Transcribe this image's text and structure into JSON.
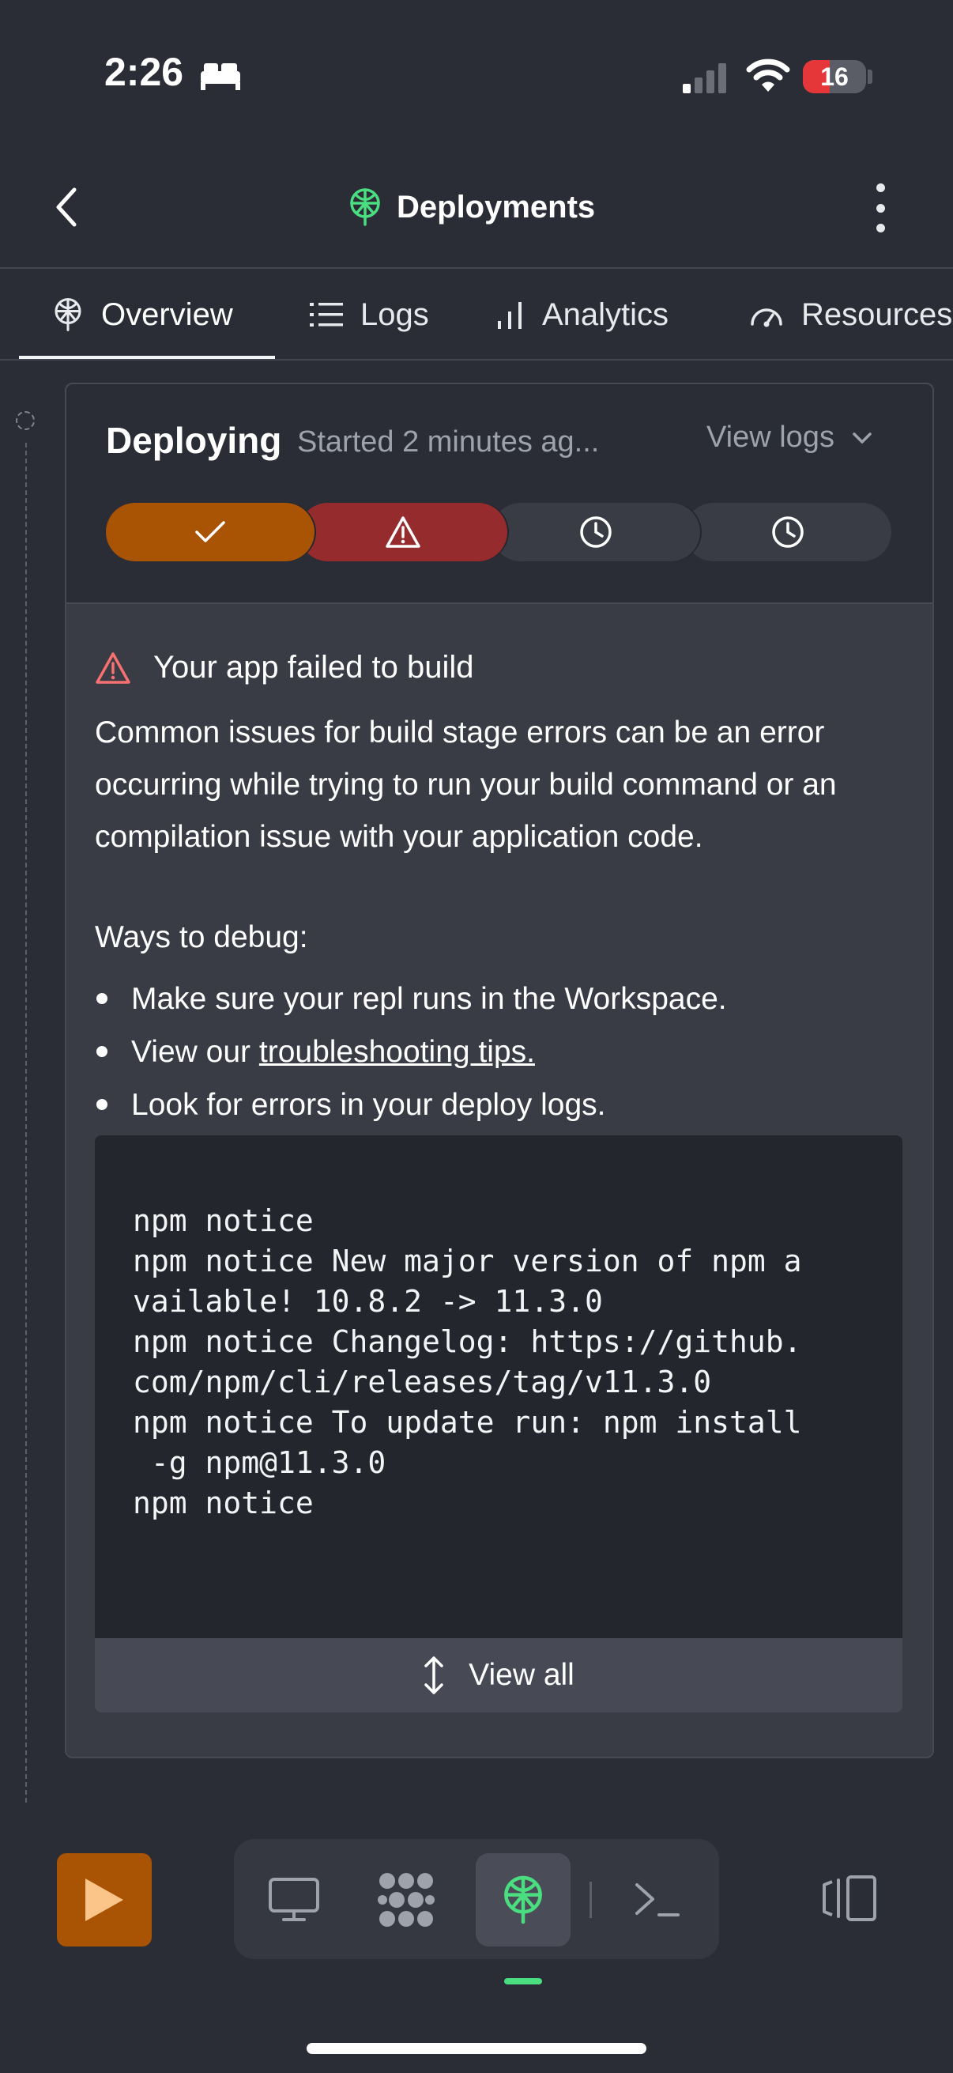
{
  "status_bar": {
    "time": "2:26",
    "battery": "16"
  },
  "header": {
    "title": "Deployments",
    "back_icon": "chevron-left-icon",
    "more_icon": "more-vertical-icon",
    "title_icon": "deploy-icon"
  },
  "tabs": [
    {
      "label": "Overview",
      "icon": "deploy-icon",
      "active": true
    },
    {
      "label": "Logs",
      "icon": "list-icon"
    },
    {
      "label": "Analytics",
      "icon": "bar-chart-icon"
    },
    {
      "label": "Resources",
      "icon": "gauge-icon"
    }
  ],
  "deployment": {
    "status": "Deploying",
    "started": "Started 2 minutes ag...",
    "view_logs": "View logs",
    "steps": [
      {
        "state": "done",
        "icon": "check-icon",
        "color": "#a95305"
      },
      {
        "state": "failed",
        "icon": "warning-icon",
        "color": "#962b2e"
      },
      {
        "state": "pending",
        "icon": "clock-icon",
        "color": "#393b45"
      },
      {
        "state": "pending",
        "icon": "clock-icon",
        "color": "#393b45"
      }
    ]
  },
  "error": {
    "title": "Your app failed to build",
    "description": "Common issues for build stage errors can be an error occurring while trying to run your build command or an compilation issue with your application code.",
    "debug_title": "Ways to debug:",
    "bullets": {
      "b1": "Make sure your repl runs in the Workspace.",
      "b2_prefix": "View our ",
      "b2_link": "troubleshooting tips.",
      "b3": "Look for errors in your deploy logs."
    }
  },
  "log": {
    "lines": [
      "npm notice",
      "npm notice New major version of npm a",
      "vailable! 10.8.2 -> 11.3.0",
      "npm notice Changelog: https://github.",
      "com/npm/cli/releases/tag/v11.3.0",
      "npm notice To update run: npm install",
      " -g npm@11.3.0",
      "npm notice"
    ],
    "view_all": "View all"
  },
  "bottom_bar": {
    "run_icon": "play-icon",
    "dock": [
      "monitor-icon",
      "apps-icon",
      "deploy-icon",
      "terminal-icon"
    ],
    "panel_icon": "panel-icon"
  },
  "colors": {
    "accent_green": "#4ade80",
    "run_orange": "#a95305",
    "error_red": "#962b2e",
    "warning_outline": "#f87171"
  }
}
